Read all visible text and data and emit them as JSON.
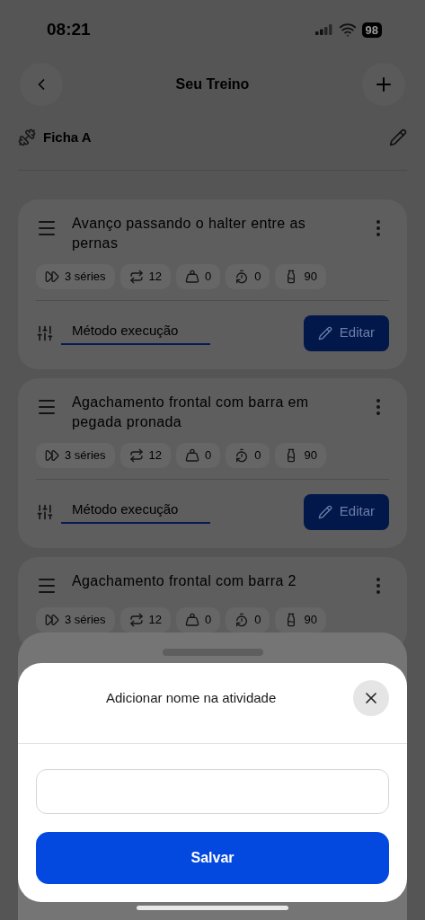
{
  "status_bar": {
    "time": "08:21",
    "battery": "98"
  },
  "header": {
    "title": "Seu Treino"
  },
  "sheet": {
    "name": "Ficha A"
  },
  "exercises": [
    {
      "name": "Avanço passando o halter entre as pernas",
      "chips": [
        {
          "kind": "sets",
          "text": "3 séries"
        },
        {
          "kind": "reps",
          "text": "12"
        },
        {
          "kind": "weight",
          "text": "0"
        },
        {
          "kind": "rest",
          "text": "0"
        },
        {
          "kind": "bottle",
          "text": "90"
        }
      ],
      "method": "Método execução",
      "edit": "Editar"
    },
    {
      "name": "Agachamento frontal com barra em pegada pronada",
      "chips": [
        {
          "kind": "sets",
          "text": "3 séries"
        },
        {
          "kind": "reps",
          "text": "12"
        },
        {
          "kind": "weight",
          "text": "0"
        },
        {
          "kind": "rest",
          "text": "0"
        },
        {
          "kind": "bottle",
          "text": "90"
        }
      ],
      "method": "Método execução",
      "edit": "Editar"
    },
    {
      "name": "Agachamento frontal com barra 2",
      "chips": [
        {
          "kind": "sets",
          "text": "3 séries"
        },
        {
          "kind": "reps",
          "text": "12"
        },
        {
          "kind": "weight",
          "text": "0"
        },
        {
          "kind": "rest",
          "text": "0"
        },
        {
          "kind": "bottle",
          "text": "90"
        }
      ]
    }
  ],
  "dialog": {
    "title": "Adicionar nome na atividade",
    "button": "Salvar"
  }
}
